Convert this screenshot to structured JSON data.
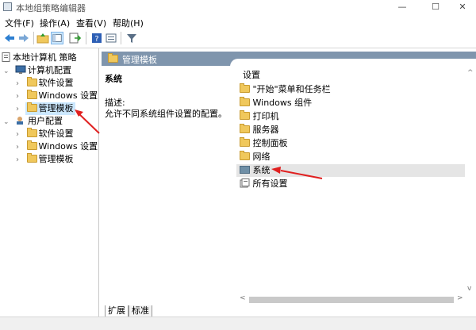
{
  "window": {
    "title": "本地组策略编辑器",
    "min": "—",
    "max": "☐",
    "close": "✕"
  },
  "menus": [
    "文件(F)",
    "操作(A)",
    "查看(V)",
    "帮助(H)"
  ],
  "tree": {
    "root": "本地计算机 策略",
    "computer": "计算机配置",
    "computer_children": [
      "软件设置",
      "Windows 设置",
      "管理模板"
    ],
    "user": "用户配置",
    "user_children": [
      "软件设置",
      "Windows 设置",
      "管理模板"
    ]
  },
  "right": {
    "header": "管理模板",
    "section_title": "系统",
    "desc_label": "描述:",
    "desc_text": "允许不同系统组件设置的配置。",
    "list_header": "设置",
    "items": [
      "\"开始\"菜单和任务栏",
      "Windows 组件",
      "打印机",
      "服务器",
      "控制面板",
      "网络",
      "系统",
      "所有设置"
    ]
  },
  "tabs": [
    "扩展",
    "标准"
  ],
  "colors": {
    "header": "#7f95ad",
    "folder": "#f0c85c",
    "arrow": "#e02020",
    "selected": "#cce8ff"
  }
}
